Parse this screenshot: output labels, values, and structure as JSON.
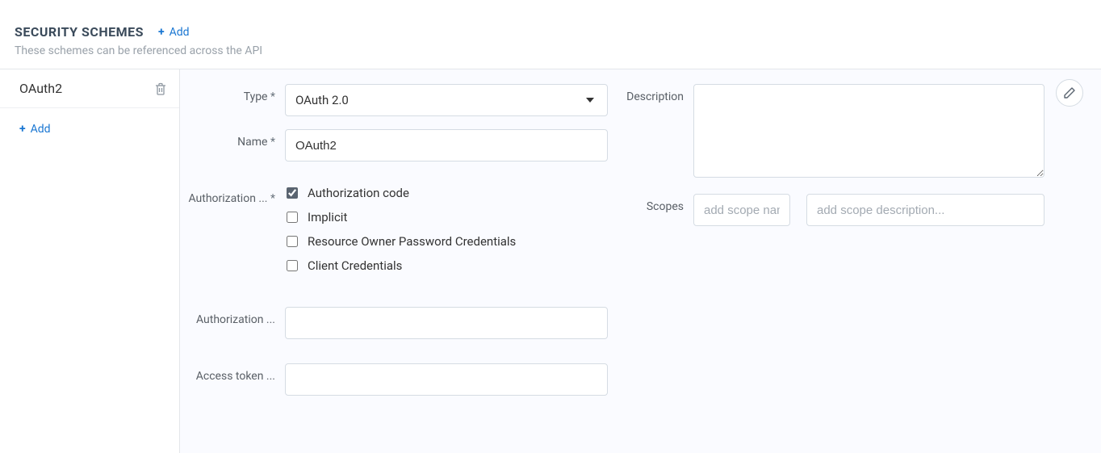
{
  "header": {
    "title": "SECURITY SCHEMES",
    "add_label": "Add",
    "subtitle": "These schemes can be referenced across the API"
  },
  "sidebar": {
    "items": [
      {
        "label": "OAuth2"
      }
    ],
    "add_label": "Add"
  },
  "form": {
    "type_label": "Type",
    "type_value": "OAuth 2.0",
    "name_label": "Name",
    "name_value": "OAuth2",
    "auth_grants_label": "Authorization ...",
    "grants": [
      {
        "label": "Authorization code",
        "checked": true
      },
      {
        "label": "Implicit",
        "checked": false
      },
      {
        "label": "Resource Owner Password Credentials",
        "checked": false
      },
      {
        "label": "Client Credentials",
        "checked": false
      }
    ],
    "auth_url_label": "Authorization ...",
    "auth_url_value": "",
    "access_token_label": "Access token ...",
    "access_token_value": "",
    "description_label": "Description",
    "description_value": "",
    "scopes_label": "Scopes",
    "scope_name_placeholder": "add scope name",
    "scope_desc_placeholder": "add scope description..."
  }
}
